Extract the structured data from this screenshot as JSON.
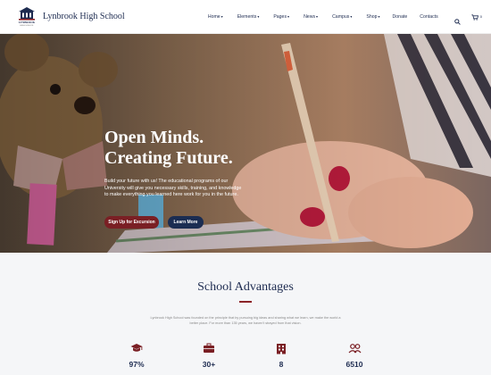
{
  "header": {
    "site_name": "Lynbrook High School",
    "logo_text": "LYNBROOK",
    "logo_subtext": "HIGH SCHOOL",
    "nav": [
      {
        "label": "Home",
        "has_dropdown": true
      },
      {
        "label": "Elements",
        "has_dropdown": true
      },
      {
        "label": "Pages",
        "has_dropdown": true
      },
      {
        "label": "News",
        "has_dropdown": true
      },
      {
        "label": "Campus",
        "has_dropdown": true
      },
      {
        "label": "Shop",
        "has_dropdown": true
      },
      {
        "label": "Donate",
        "has_dropdown": false
      },
      {
        "label": "Contacts",
        "has_dropdown": false
      }
    ],
    "search_icon": "search-icon",
    "cart_icon": "cart-icon",
    "cart_count": "0"
  },
  "hero": {
    "title_line1": "Open Minds.",
    "title_line2": "Creating Future.",
    "text": "Build your future with us! The educational programs of our University will give you necessary skills, training, and knowledge to make everything you learned here work for you in the future.",
    "button_primary": "Sign Up for Excursion",
    "button_secondary": "Learn More"
  },
  "advantages": {
    "title": "School Advantages",
    "description": "Lynbrook High School was founded on the principle that by pursuing big ideas and sharing what we learn, we make the world a better place. For more than 135 years, we haven't strayed from that vision.",
    "stats": [
      {
        "icon": "graduation-cap-icon",
        "value": "97%"
      },
      {
        "icon": "briefcase-icon",
        "value": "30+"
      },
      {
        "icon": "building-icon",
        "value": "8"
      },
      {
        "icon": "users-icon",
        "value": "6510"
      }
    ]
  },
  "colors": {
    "navy": "#1d2b50",
    "maroon": "#7a1f24",
    "accent_line": "#8b2328",
    "section_bg": "#f5f6f8"
  }
}
